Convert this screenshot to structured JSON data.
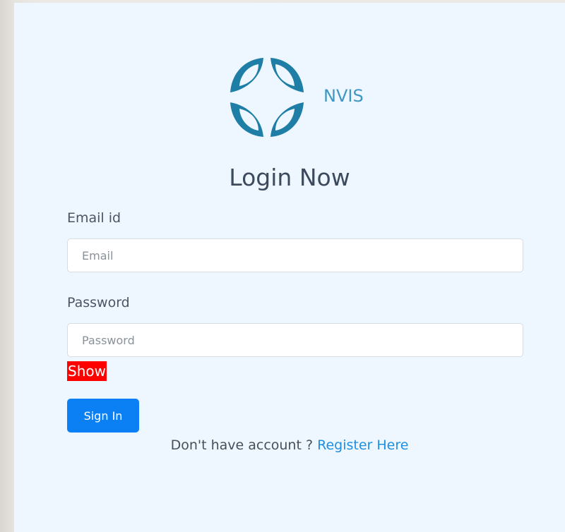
{
  "brand": {
    "name": "NVIS",
    "logo_icon": "nvis-logo-icon",
    "color": "#3f98c3"
  },
  "form": {
    "title": "Login Now",
    "email_label": "Email id",
    "email_placeholder": "Email",
    "password_label": "Password",
    "password_placeholder": "Password",
    "show_label": "Show",
    "signin_label": "Sign In",
    "account_prompt": "Don't have account ?",
    "register_label": "Register Here"
  },
  "colors": {
    "page_bg": "#eef7ff",
    "primary": "#0a80f4",
    "show_bg": "#ff0000",
    "link": "#1f8fe0"
  }
}
